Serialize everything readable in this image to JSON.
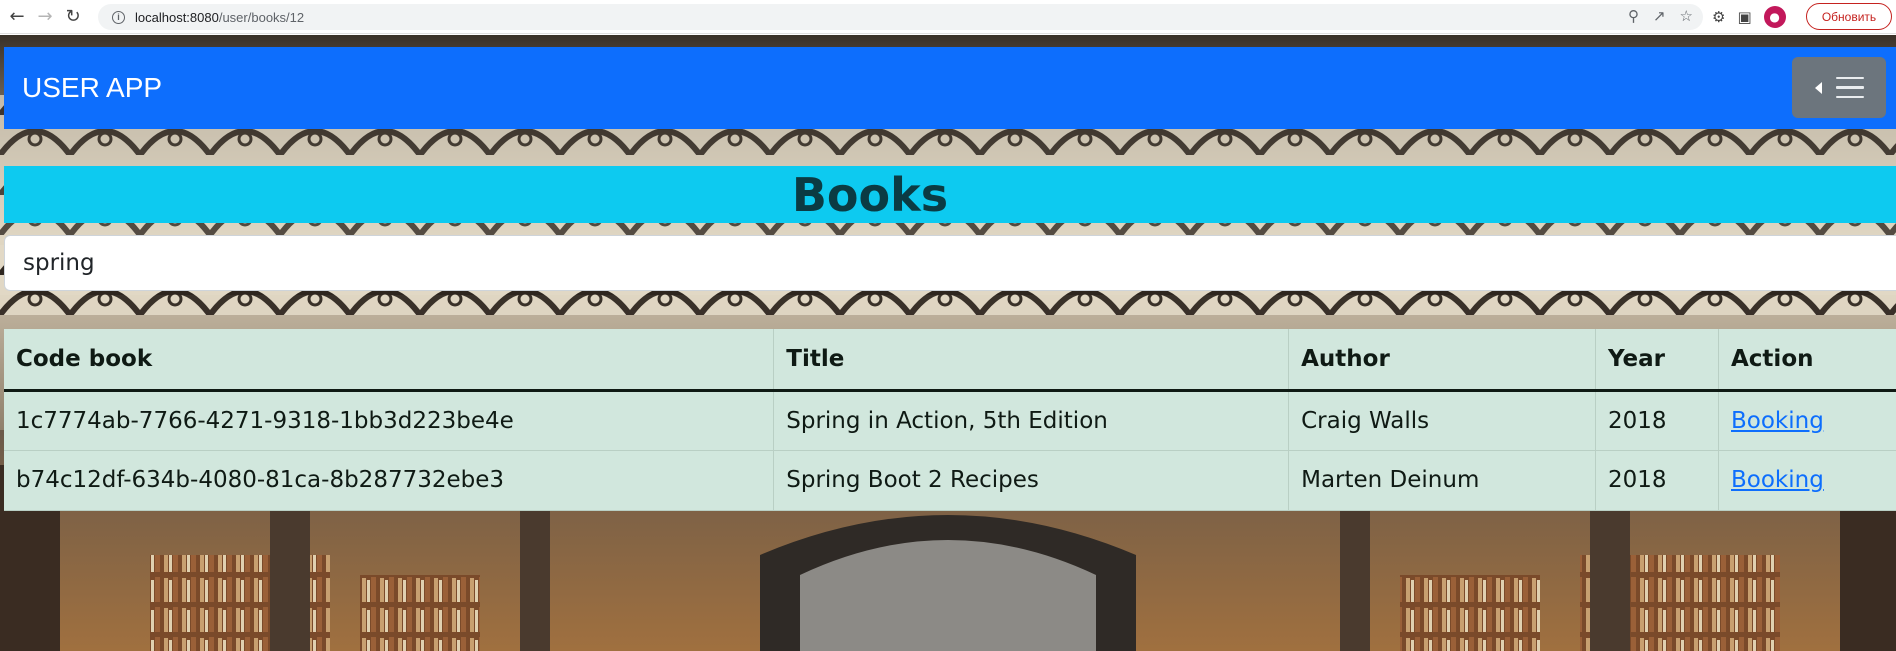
{
  "browser": {
    "url_host": "localhost:8080",
    "url_path": "/user/books/12",
    "update_label": "Обновить"
  },
  "navbar": {
    "brand": "USER APP"
  },
  "page_title": "Books",
  "search": {
    "value": "spring"
  },
  "table": {
    "headers": [
      "Code book",
      "Title",
      "Author",
      "Year",
      "Action"
    ],
    "rows": [
      {
        "code": "1c7774ab-7766-4271-9318-1bb3d223be4e",
        "title": "Spring in Action, 5th Edition",
        "author": "Craig Walls",
        "year": "2018",
        "action": "Booking"
      },
      {
        "code": "b74c12df-634b-4080-81ca-8b287732ebe3",
        "title": "Spring Boot 2 Recipes",
        "author": "Marten Deinum",
        "year": "2018",
        "action": "Booking"
      }
    ]
  }
}
